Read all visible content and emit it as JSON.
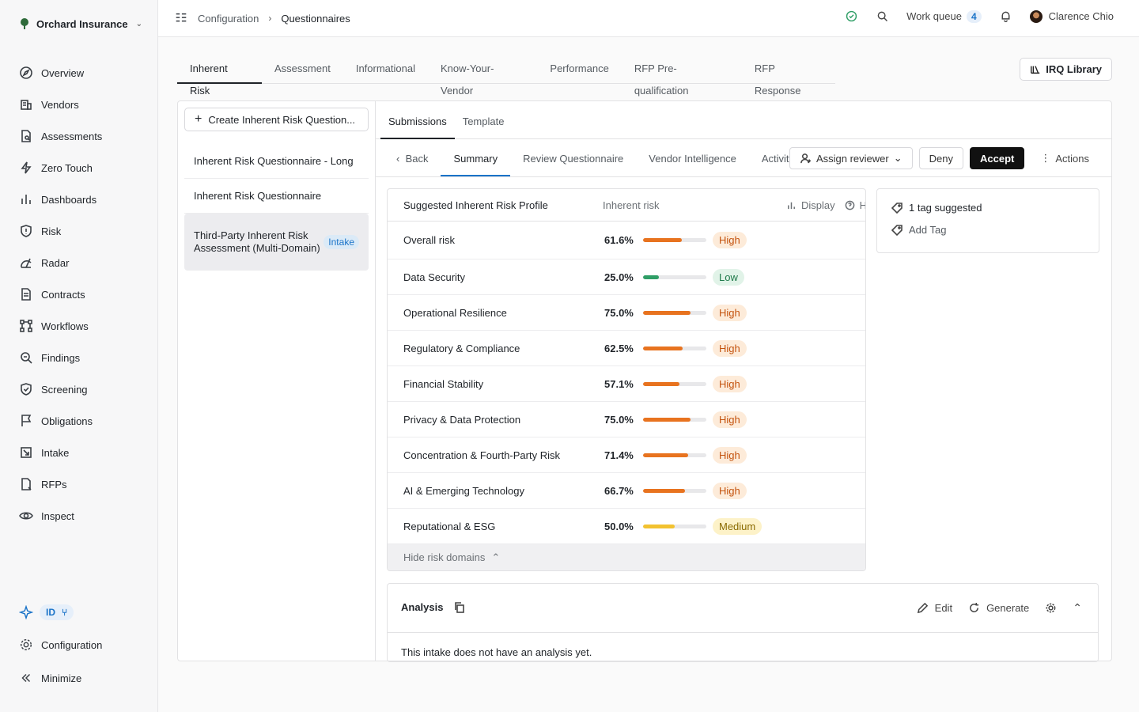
{
  "org": {
    "name": "Orchard Insurance"
  },
  "nav": [
    {
      "label": "Overview",
      "icon": "compass-icon"
    },
    {
      "label": "Vendors",
      "icon": "building-icon"
    },
    {
      "label": "Assessments",
      "icon": "document-search-icon"
    },
    {
      "label": "Zero Touch",
      "icon": "lightning-icon"
    },
    {
      "label": "Dashboards",
      "icon": "bar-chart-icon"
    },
    {
      "label": "Risk",
      "icon": "shield-alert-icon"
    },
    {
      "label": "Radar",
      "icon": "radar-icon"
    },
    {
      "label": "Contracts",
      "icon": "contract-icon"
    },
    {
      "label": "Workflows",
      "icon": "workflow-icon"
    },
    {
      "label": "Findings",
      "icon": "findings-icon"
    },
    {
      "label": "Screening",
      "icon": "shield-check-icon"
    },
    {
      "label": "Obligations",
      "icon": "flag-icon"
    },
    {
      "label": "Intake",
      "icon": "intake-icon"
    },
    {
      "label": "RFPs",
      "icon": "rfp-icon"
    },
    {
      "label": "Inspect",
      "icon": "eye-icon"
    }
  ],
  "sidebar_bottom": {
    "id_chip": "ID",
    "configuration": "Configuration",
    "minimize": "Minimize"
  },
  "breadcrumb": {
    "parent": "Configuration",
    "current": "Questionnaires"
  },
  "topbar": {
    "work_queue": "Work queue",
    "work_queue_count": "4",
    "user": "Clarence Chio"
  },
  "questionnaire_tabs": [
    "Inherent Risk",
    "Assessment",
    "Informational",
    "Know-Your-Vendor",
    "Performance",
    "RFP Pre-qualification",
    "RFP Response"
  ],
  "irq_library": "IRQ Library",
  "create_button": "Create Inherent Risk Question...",
  "questionnaires": [
    {
      "name": "Inherent Risk Questionnaire - Long"
    },
    {
      "name": "Inherent Risk Questionnaire"
    },
    {
      "name": "Third-Party Inherent Risk Assessment (Multi-Domain)",
      "badge": "Intake"
    }
  ],
  "sub_tabs": [
    "Submissions",
    "Template"
  ],
  "toolbar": {
    "back": "Back",
    "tabs": [
      "Summary",
      "Review Questionnaire",
      "Vendor Intelligence",
      "Activity"
    ],
    "assign_reviewer": "Assign reviewer",
    "deny": "Deny",
    "accept": "Accept",
    "actions": "Actions"
  },
  "risk_profile": {
    "title": "Suggested Inherent Risk Profile",
    "column": "Inherent risk",
    "display": "Display",
    "help": "He",
    "rows": [
      {
        "domain": "Overall risk",
        "pct": "61.6%",
        "value": 61.6,
        "level": "High"
      },
      {
        "domain": "Data Security",
        "pct": "25.0%",
        "value": 25.0,
        "level": "Low"
      },
      {
        "domain": "Operational Resilience",
        "pct": "75.0%",
        "value": 75.0,
        "level": "High"
      },
      {
        "domain": "Regulatory & Compliance",
        "pct": "62.5%",
        "value": 62.5,
        "level": "High"
      },
      {
        "domain": "Financial Stability",
        "pct": "57.1%",
        "value": 57.1,
        "level": "High"
      },
      {
        "domain": "Privacy & Data Protection",
        "pct": "75.0%",
        "value": 75.0,
        "level": "High"
      },
      {
        "domain": "Concentration & Fourth-Party Risk",
        "pct": "71.4%",
        "value": 71.4,
        "level": "High"
      },
      {
        "domain": "AI & Emerging Technology",
        "pct": "66.7%",
        "value": 66.7,
        "level": "High"
      },
      {
        "domain": "Reputational & ESG",
        "pct": "50.0%",
        "value": 50.0,
        "level": "Medium"
      }
    ],
    "hide_label": "Hide risk domains"
  },
  "level_colors": {
    "High": {
      "bar": "#e8731f",
      "bg": "#fdebd9",
      "fg": "#c4530e"
    },
    "Low": {
      "bar": "#2f9e66",
      "bg": "#e1f3e8",
      "fg": "#1f7a4a"
    },
    "Medium": {
      "bar": "#f2c230",
      "bg": "#fdf2c8",
      "fg": "#8a6a00"
    }
  },
  "tags": {
    "suggested": "1 tag suggested",
    "add": "Add Tag"
  },
  "analysis": {
    "title": "Analysis",
    "edit": "Edit",
    "generate": "Generate",
    "empty": "This intake does not have an analysis yet."
  }
}
